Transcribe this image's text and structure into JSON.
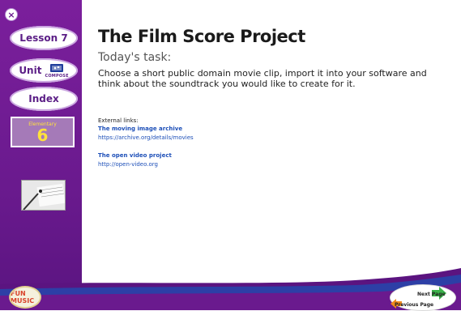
{
  "sidebar": {
    "close_label": "×",
    "lesson_label": "Lesson 7",
    "unit_label": "Unit",
    "compose_label": "COMPOSE",
    "index_label": "Index",
    "level": {
      "label": "Elementary",
      "number": "6"
    }
  },
  "main": {
    "title": "The Film Score Project",
    "subtitle": "Today's task:",
    "task": "Choose a short public domain movie clip, import it into your software and think about the soundtrack you would like to create for it.",
    "external_label": "External links:",
    "links": [
      {
        "title": "The moving image archive",
        "url": "https://archive.org/details/movies"
      },
      {
        "title": "The open video project",
        "url": "http://open-video.org"
      }
    ]
  },
  "footer": {
    "next_label": "Next Page",
    "prev_label": "Previous Page",
    "logo_text": "FUN MUSIC"
  },
  "colors": {
    "sidebar": "#6a1a8e",
    "level_number": "#ffe23b",
    "link": "#1d4fb8",
    "next_arrow": "#3bb34a",
    "prev_arrow": "#f08a1d"
  },
  "icons": {
    "close": "close-icon",
    "compose": "compose-icon",
    "next": "next-arrow-icon",
    "prev": "prev-arrow-icon",
    "expand": "expand-icon"
  }
}
